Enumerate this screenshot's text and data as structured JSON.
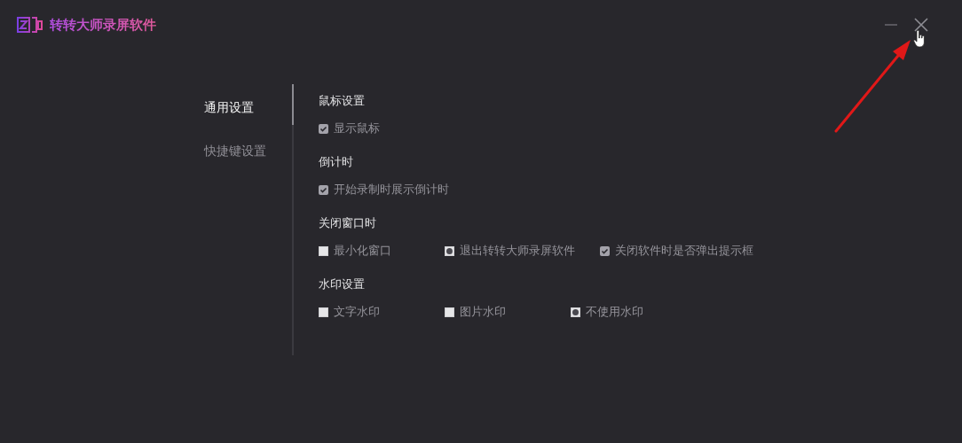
{
  "window": {
    "title": "转转大师录屏软件"
  },
  "nav": [
    {
      "label": "通用设置",
      "selected": true
    },
    {
      "label": "快捷键设置",
      "selected": false
    }
  ],
  "sections": [
    {
      "title": "鼠标设置",
      "options": [
        {
          "kind": "checkbox",
          "label": "显示鼠标",
          "checked": true
        }
      ]
    },
    {
      "title": "倒计时",
      "options": [
        {
          "kind": "checkbox",
          "label": "开始录制时展示倒计时",
          "checked": true
        }
      ]
    },
    {
      "title": "关闭窗口时",
      "options": [
        {
          "kind": "radio",
          "label": "最小化窗口",
          "selected": false
        },
        {
          "kind": "radio",
          "label": "退出转转大师录屏软件",
          "selected": true
        },
        {
          "kind": "checkbox",
          "label": "关闭软件时是否弹出提示框",
          "checked": true
        }
      ]
    },
    {
      "title": "水印设置",
      "options": [
        {
          "kind": "radio",
          "label": "文字水印",
          "selected": false
        },
        {
          "kind": "radio",
          "label": "图片水印",
          "selected": false
        },
        {
          "kind": "radio",
          "label": "不使用水印",
          "selected": true
        }
      ]
    }
  ]
}
